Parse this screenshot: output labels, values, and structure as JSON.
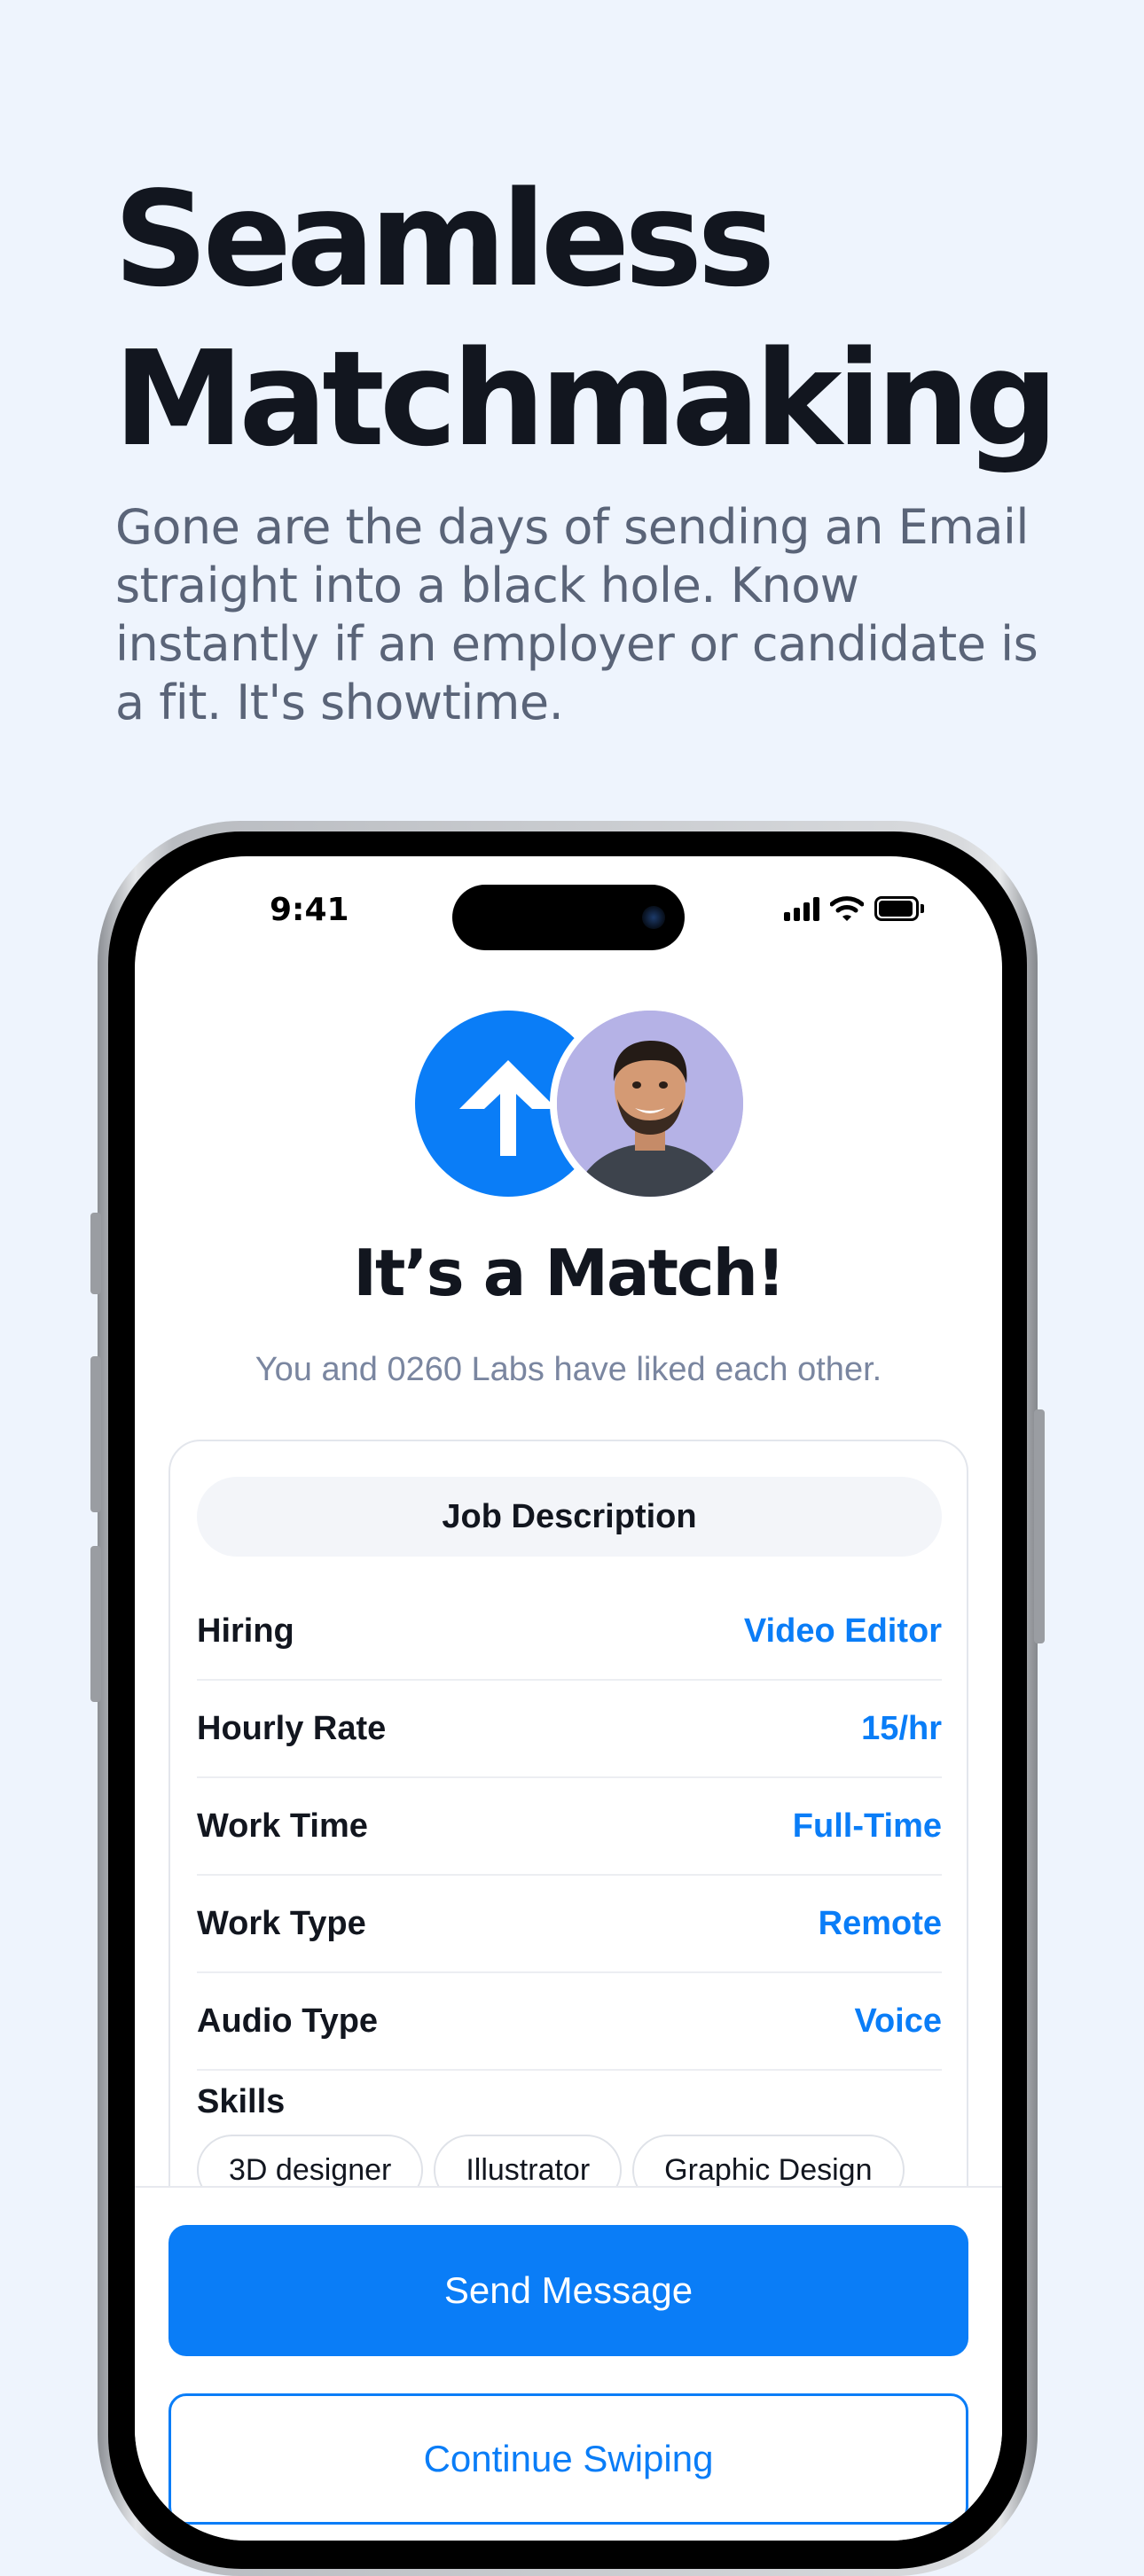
{
  "hero": {
    "headline_line1": "Seamless",
    "headline_line2": "Matchmaking",
    "description": "Gone are the days of sending an Email straight into a black hole. Know instantly if an employer or candidate is a fit. It's showtime."
  },
  "status_bar": {
    "time": "9:41",
    "icons": [
      "cellular-signal-icon",
      "wifi-icon",
      "battery-icon"
    ]
  },
  "match": {
    "logo_icon": "arrow-up-icon",
    "title": "It’s a Match!",
    "subtitle": "You and 0260 Labs have liked each other."
  },
  "job": {
    "header": "Job Description",
    "rows": [
      {
        "label": "Hiring",
        "value": "Video Editor"
      },
      {
        "label": "Hourly Rate",
        "value": "15/hr"
      },
      {
        "label": "Work Time",
        "value": "Full-Time"
      },
      {
        "label": "Work Type",
        "value": "Remote"
      },
      {
        "label": "Audio Type",
        "value": "Voice"
      }
    ],
    "skills_label": "Skills",
    "skills": [
      "3D designer",
      "Illustrator",
      "Graphic Design"
    ]
  },
  "actions": {
    "send_message": "Send Message",
    "continue_swiping": "Continue Swiping"
  },
  "colors": {
    "background": "#eef4fd",
    "accent": "#0a7df7",
    "headline": "#12161f",
    "body_text": "#5a6478"
  }
}
